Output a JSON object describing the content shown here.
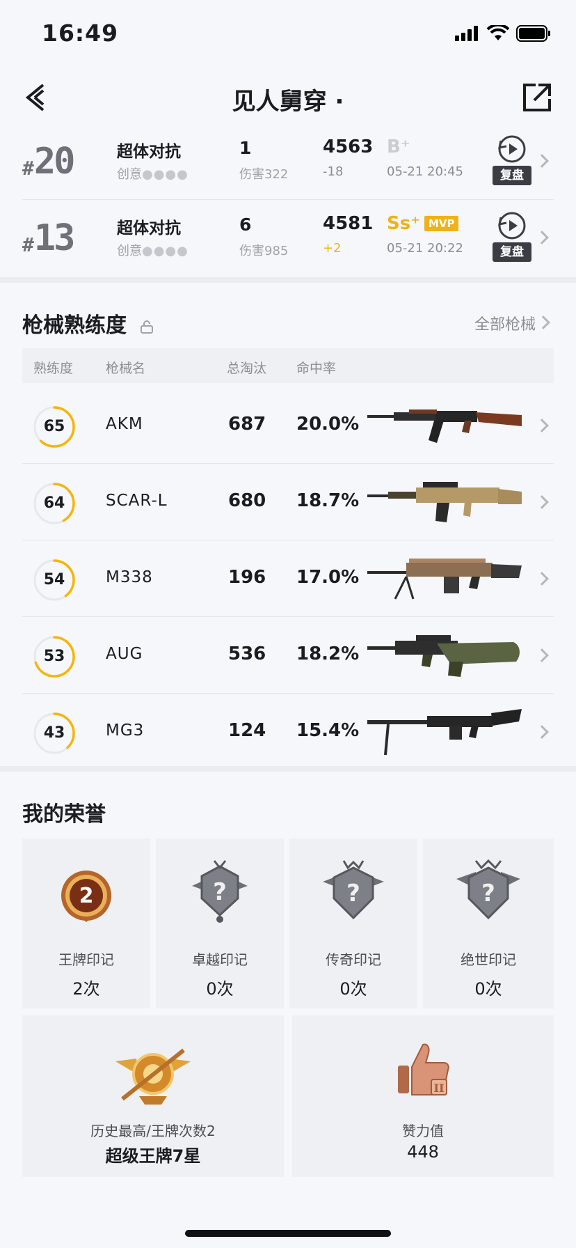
{
  "status": {
    "time": "16:49"
  },
  "header": {
    "title": "见人舅穿 ·"
  },
  "matches": [
    {
      "hash": "#",
      "rank": "20",
      "mode": "超体对抗",
      "sub_label": "创意",
      "sub_dots": "●●●●",
      "kills": "1",
      "damage": "伤害322",
      "score": "4563",
      "delta": "-18",
      "grade": "B⁺",
      "mvp": "",
      "date": "05-21 20:45",
      "replay_label": "复盘"
    },
    {
      "hash": "#",
      "rank": "13",
      "mode": "超体对抗",
      "sub_label": "创意",
      "sub_dots": "●●●●",
      "kills": "6",
      "damage": "伤害985",
      "score": "4581",
      "delta": "+2",
      "grade": "Ss⁺",
      "mvp": "MVP",
      "date": "05-21 20:22",
      "replay_label": "复盘"
    }
  ],
  "weapons_section": {
    "title": "枪械熟练度",
    "all_link": "全部枪械",
    "columns": [
      "熟练度",
      "枪械名",
      "总淘汰",
      "命中率"
    ],
    "rows": [
      {
        "level": "65",
        "name": "AKM",
        "kills": "687",
        "rate": "20.0%",
        "progress": 0.62
      },
      {
        "level": "64",
        "name": "SCAR-L",
        "kills": "680",
        "rate": "18.7%",
        "progress": 0.42
      },
      {
        "level": "54",
        "name": "M338",
        "kills": "196",
        "rate": "17.0%",
        "progress": 0.4
      },
      {
        "level": "53",
        "name": "AUG",
        "kills": "536",
        "rate": "18.2%",
        "progress": 0.7
      },
      {
        "level": "43",
        "name": "MG3",
        "kills": "124",
        "rate": "15.4%",
        "progress": 0.38
      }
    ]
  },
  "honors_section": {
    "title": "我的荣誉",
    "badges": [
      {
        "label": "王牌印记",
        "count": "2次",
        "badge_number": "2"
      },
      {
        "label": "卓越印记",
        "count": "0次"
      },
      {
        "label": "传奇印记",
        "count": "0次"
      },
      {
        "label": "绝世印记",
        "count": "0次"
      }
    ],
    "highest": {
      "label": "历史最高/王牌次数2",
      "value": "超级王牌7星"
    },
    "likes": {
      "label": "赞力值",
      "value": "448"
    }
  },
  "colors": {
    "accent": "#f5b50a",
    "grade_gold": "#f0b21a",
    "negative": "#8a8d92",
    "positive": "#f0b21a"
  }
}
